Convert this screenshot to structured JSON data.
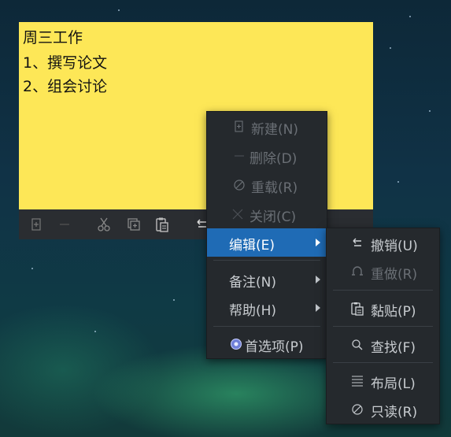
{
  "note": {
    "lines": [
      "周三工作",
      "1、撰写论文",
      "2、组会讨论"
    ]
  },
  "toolbar": {
    "icons": [
      "new-note-icon",
      "delete-icon",
      "cut-icon",
      "copy-icon",
      "paste-icon",
      "undo-icon"
    ]
  },
  "context_menu": {
    "items": [
      {
        "label": "新建(N)",
        "icon": "new-note-icon",
        "disabled": true
      },
      {
        "label": "删除(D)",
        "icon": "minus-icon",
        "disabled": true
      },
      {
        "label": "重载(R)",
        "icon": "no-entry-icon",
        "disabled": true
      },
      {
        "label": "关闭(C)",
        "icon": "close-icon",
        "disabled": true
      },
      {
        "label": "编辑(E)",
        "submenu": true,
        "active": true
      },
      {
        "label": "备注(N)",
        "submenu": true
      },
      {
        "label": "帮助(H)",
        "submenu": true
      },
      {
        "label": "首选项(P)",
        "icon": "preferences-gear-icon"
      }
    ]
  },
  "edit_submenu": {
    "items": [
      {
        "label": "撤销(U)",
        "icon": "undo-icon"
      },
      {
        "label": "重做(R)",
        "icon": "redo-icon",
        "disabled": true
      },
      {
        "label": "黏贴(P)",
        "icon": "paste-icon"
      },
      {
        "label": "查找(F)",
        "icon": "search-icon"
      },
      {
        "label": "布局(L)",
        "icon": "layout-lines-icon"
      },
      {
        "label": "只读(R)",
        "icon": "read-only-icon"
      }
    ]
  },
  "colors": {
    "note_bg": "#fde757",
    "menu_bg": "#25292d",
    "highlight": "#1f6bb5"
  }
}
